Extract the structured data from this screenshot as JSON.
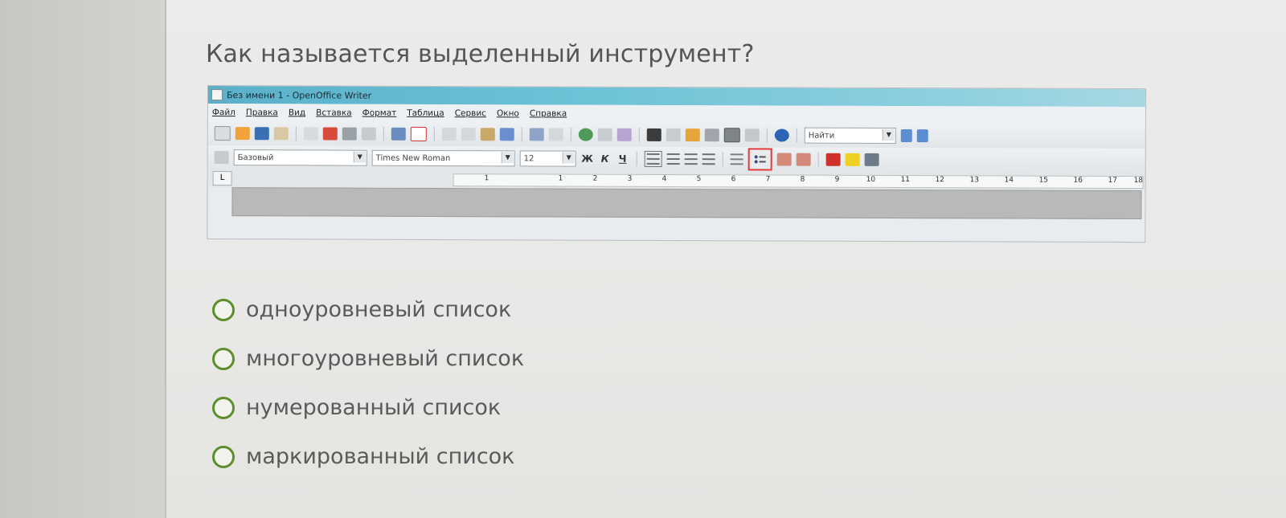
{
  "question": "Как называется выделенный инструмент?",
  "screenshot": {
    "window_title": "Без имени 1 - OpenOffice Writer",
    "menu": [
      "Файл",
      "Правка",
      "Вид",
      "Вставка",
      "Формат",
      "Таблица",
      "Сервис",
      "Окно",
      "Справка"
    ],
    "search_placeholder": "Найти",
    "style_value": "Базовый",
    "font_value": "Times New Roman",
    "size_value": "12",
    "bold": "Ж",
    "italic": "К",
    "underline": "Ч",
    "ruler_numbers": [
      "1",
      "1",
      "2",
      "3",
      "4",
      "5",
      "6",
      "7",
      "8",
      "9",
      "10",
      "11",
      "12",
      "13",
      "14",
      "15",
      "16",
      "17",
      "18"
    ]
  },
  "options": [
    {
      "label": "одноуровневый список"
    },
    {
      "label": "многоуровневый список"
    },
    {
      "label": "нумерованный список"
    },
    {
      "label": "маркированный список"
    }
  ],
  "colors": {
    "radio": "#5d8e2c",
    "highlight": "#e23a3a"
  }
}
